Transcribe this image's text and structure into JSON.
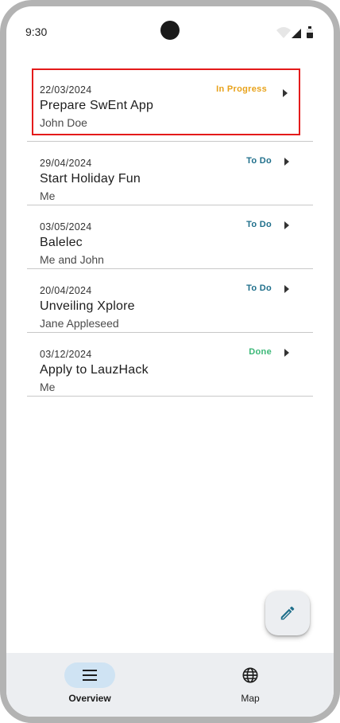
{
  "status_bar": {
    "time": "9:30"
  },
  "tasks": [
    {
      "date": "22/03/2024",
      "title": "Prepare SwEnt App",
      "assignee": "John Doe",
      "status": "In Progress",
      "status_color": "#e8a21a"
    },
    {
      "date": "29/04/2024",
      "title": "Start Holiday Fun",
      "assignee": "Me",
      "status": "To Do",
      "status_color": "#1f6f8b"
    },
    {
      "date": "03/05/2024",
      "title": "Balelec",
      "assignee": "Me and John",
      "status": "To Do",
      "status_color": "#1f6f8b"
    },
    {
      "date": "20/04/2024",
      "title": "Unveiling Xplore",
      "assignee": "Jane Appleseed",
      "status": "To Do",
      "status_color": "#1f6f8b"
    },
    {
      "date": "03/12/2024",
      "title": "Apply to LauzHack",
      "assignee": "Me",
      "status": "Done",
      "status_color": "#3cb878"
    }
  ],
  "fab": {
    "icon": "pencil-icon",
    "color": "#1f6f8b"
  },
  "bottom_nav": {
    "items": [
      {
        "label": "Overview",
        "icon": "menu-icon",
        "active": true
      },
      {
        "label": "Map",
        "icon": "globe-icon",
        "active": false
      }
    ]
  },
  "colors": {
    "highlight_border": "#e41b1b",
    "nav_active_pill": "#cfe3f3",
    "nav_background": "#eceef1"
  }
}
